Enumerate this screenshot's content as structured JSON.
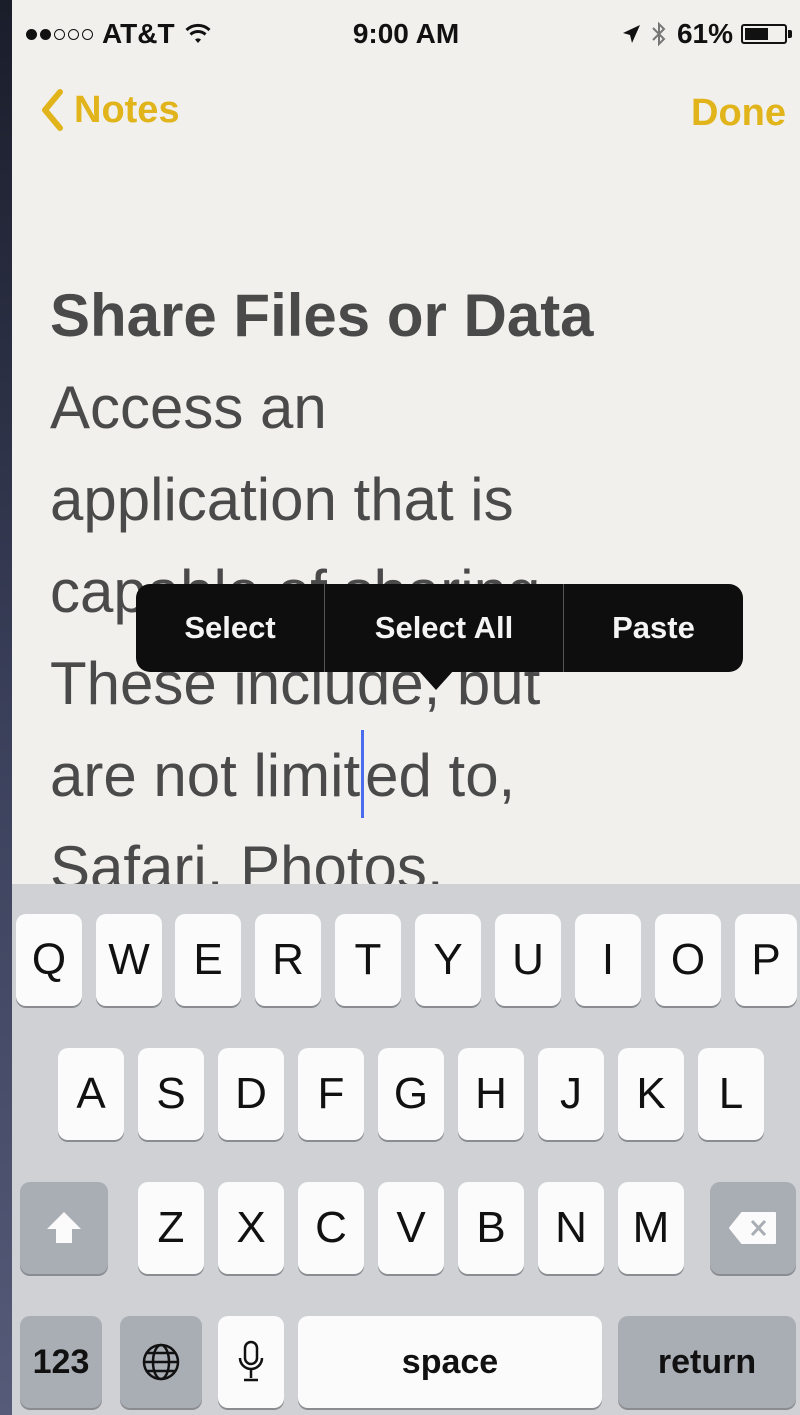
{
  "status_bar": {
    "signal_dots_filled": 2,
    "signal_dots_total": 5,
    "carrier": "AT&T",
    "time": "9:00 AM",
    "battery_percent": "61%",
    "battery_level": 0.61,
    "icons": [
      "wifi-icon",
      "location-arrow-icon",
      "bluetooth-icon",
      "battery-icon"
    ]
  },
  "nav": {
    "back_label": "Notes",
    "done_label": "Done",
    "accent_color": "#e0b41a"
  },
  "note": {
    "title": "Share Files or Data",
    "lines": [
      "Access an",
      "application that is",
      "capable of sharing.",
      "These include, but",
      "are not limited to,",
      "Safari, Photos,"
    ],
    "cursor_line_before": "are not limit",
    "cursor_line_after": "ed to,"
  },
  "edit_menu": {
    "items": [
      "Select",
      "Select All",
      "Paste"
    ]
  },
  "keyboard": {
    "row1": [
      "Q",
      "W",
      "E",
      "R",
      "T",
      "Y",
      "U",
      "I",
      "O",
      "P"
    ],
    "row2": [
      "A",
      "S",
      "D",
      "F",
      "G",
      "H",
      "J",
      "K",
      "L"
    ],
    "row3": [
      "Z",
      "X",
      "C",
      "V",
      "B",
      "N",
      "M"
    ],
    "numbers_label": "123",
    "space_label": "space",
    "return_label": "return",
    "icons": [
      "shift-icon",
      "backspace-icon",
      "globe-icon",
      "microphone-icon"
    ]
  }
}
